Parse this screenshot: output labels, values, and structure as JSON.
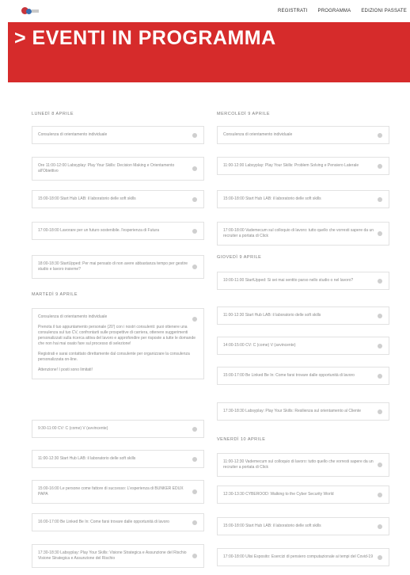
{
  "nav": {
    "items": [
      "REGISTRATI",
      "PROGRAMMA",
      "EDIZIONI PASSATE"
    ]
  },
  "hero": {
    "title": "> EVENTI IN PROGRAMMA"
  },
  "left": {
    "day1": "LUNEDÌ 8 APRILE",
    "day1_events": [
      "Consulenza di orientamento individuale",
      "Ore 11:00-12:00 Labsyplay: Play Your Skills: Decision Making e Orientamento all'Obiettivo",
      "15:00-18:00 Start Hub LAB: il laboratorio delle soft skills",
      "17:00-18:00 Lavorare per un futuro sostenibile. l'esperienza di Futura",
      "18:00-18:30 StartUpped: Per mai pensato di non avere abbastanza tempo per gestire studio e lavoro insieme?"
    ],
    "day2": "MARTEDÌ 9 APRILE",
    "day2_open": {
      "title": "Consulenza di orientamento individuale",
      "p1": "Prenota il tuo appuntamento personale (20') con i nostri consulenti: puoi ottenere una consulenza sul tuo CV, confrontarti sulle prospettive di carriera, ottenere suggerimenti personalizzati sulla ricerca attiva del lavoro e approfondire per risposte a tutte le domande che non hai mai osato fare sul processo di selezione!",
      "p2": "Registrati e sarai contattato direttamente dal consulente per organizzare la consulenza personalizzata on-line.",
      "p3": "Attenzione! I posti sono limitati!"
    },
    "day2_events": [
      "9:30-11:00 CV: C (come) V (avvincente)",
      "11:00-12:30 Start Hub LAB: il laboratorio delle soft skills",
      "15:00-16:00 Le persone come fattore di successo: L'esperienza di BUNKER EDUX PAPA",
      "16:00-17:00 Be Linked Be In: Come farsi trovare dalle opportunità di lavoro",
      "17:30-18:30 Labsyplay: Play Your Skills: Visione Strategica e Assunzione del Rischio Visione Strategica e Assunzione del Rischio"
    ]
  },
  "right": {
    "day1": "MERCOLEDÌ 9 APRILE",
    "day1_events": [
      "Consulenza di orientamento individuale",
      "11:00-12:00 Labsyplay: Play Your Skills: Problem Solving e Pensiero Laterale",
      "15:00-18:00 Start Hub LAB: il laboratorio delle soft skills",
      "17:00-18:00 Vademecum sul colloquio di lavoro: tutto quello che vorresti sapere da un recruiter a portata di Click"
    ],
    "day2": "GIOVEDÌ 9 APRILE",
    "day2_events": [
      "10:00-11:00 StartUpped: Si sei mai sentito parso nello studio o nel lavoro?",
      "11:00-12:30 Start Hub LAB: il laboratorio delle soft skills",
      "14:00-15:00 CV: C (come) V (avvincente)",
      "15:00-17:00 Be Linked Be In: Come farsi trovare dalle opportunità di lavoro",
      "17:30-18:30 Labsyplay: Play Your Skills: Resilienza sul orientamento al Cliente"
    ],
    "day3": "VENERDÌ 10 APRILE",
    "day3_events": [
      "11:00-12:30 Vademecum sul colloquio di lavoro: tutto quello che vorresti sapere da un recruiter a portata di Click",
      "12:30-13:30 CYBEROOD: Walking to the Cyber Security World",
      "15:00-18:00 Start Hub LAB: il laboratorio delle soft skills",
      "17:00-18:00 Ulisi Esposito: Esercizi di pensiero computazionale ai tempi del Covid-19"
    ]
  },
  "colors": {
    "accent": "#d62b2b",
    "card_border": "#e2e2e2",
    "plus": "#cfcfcf"
  },
  "icons": {
    "expand": "plus-icon"
  }
}
